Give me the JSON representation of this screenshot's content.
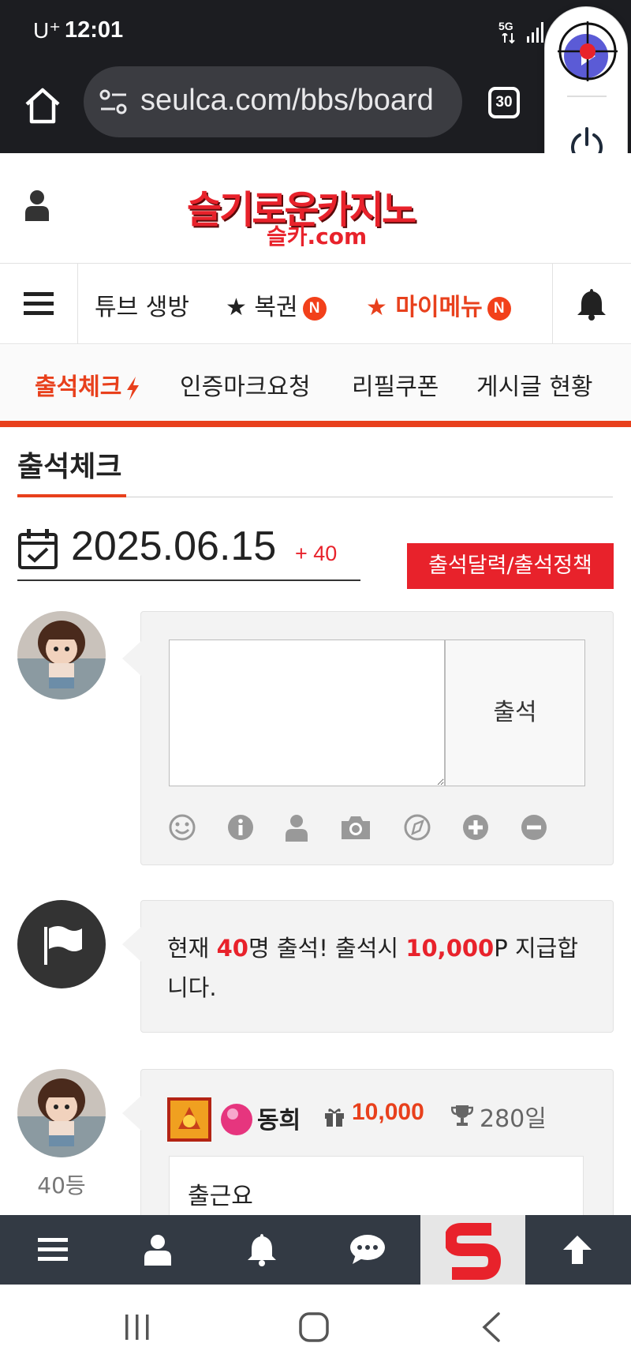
{
  "status_bar": {
    "carrier": "U⁺",
    "time": "12:01",
    "network": "5G"
  },
  "browser": {
    "url": "seulca.com/bbs/board",
    "tab_count": "30"
  },
  "site": {
    "logo_main": "슬기로운카지노",
    "logo_sub": "슬카.com"
  },
  "nav_primary": {
    "items": [
      {
        "label": "튜브 생방",
        "badge": ""
      },
      {
        "label": "★ 복권",
        "badge": "N"
      },
      {
        "label": "★ 마이메뉴",
        "badge": "N"
      }
    ]
  },
  "nav_secondary": {
    "items": [
      {
        "label": "출석체크"
      },
      {
        "label": "인증마크요청"
      },
      {
        "label": "리필쿠폰"
      },
      {
        "label": "게시글 현황"
      }
    ]
  },
  "page": {
    "title": "출석체크",
    "date": "2025.06.15",
    "date_plus": "+ 40",
    "calendar_button": "출석달력/출석정책",
    "submit_button": "출석",
    "textarea_value": "",
    "notice": {
      "prefix": "현재 ",
      "count": "40",
      "mid": "명 출석! 출석시 ",
      "points": "10,000",
      "suffix": "P 지급합니다."
    },
    "entry": {
      "rank": "40등",
      "username": "동희",
      "points": "10,000",
      "days": "280일",
      "message": "출근요"
    }
  },
  "colors": {
    "accent": "#e8401c",
    "brand_red": "#e8222b",
    "bottom_bar": "#333a44"
  }
}
